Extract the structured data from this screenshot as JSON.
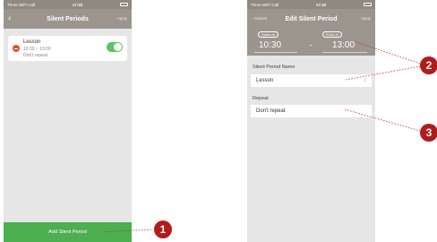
{
  "left_screen": {
    "status": {
      "carrier": "Three WiFi Call",
      "time": "17:32"
    },
    "nav": {
      "back_icon": "chevron-left-icon",
      "title": "Silent Periods",
      "right": "Apply"
    },
    "period": {
      "name": "Lesson",
      "time": "10:30 ~ 13:00",
      "repeat": "Don't repeat",
      "enabled": true
    },
    "add_button": "Add Silent Period"
  },
  "right_screen": {
    "status": {
      "carrier": "Three WiFi Call",
      "time": "17:32"
    },
    "nav": {
      "cancel": "Cancel",
      "title": "Edit Silent Period",
      "apply": "Apply"
    },
    "starts_label": "Starts at",
    "starts_value": "10:30",
    "separator": "~",
    "ends_label": "Ends at",
    "ends_value": "13:00",
    "name_label": "Silent Period Name",
    "name_value": "Lesson",
    "repeat_label": "Repeat",
    "repeat_value": "Don't repeat"
  },
  "callouts": [
    "1",
    "2",
    "3"
  ],
  "colors": {
    "header": "#9b958d",
    "accent_green": "#4caf50",
    "badge_red": "#b31a1a",
    "minus_red": "#e74a3b"
  }
}
